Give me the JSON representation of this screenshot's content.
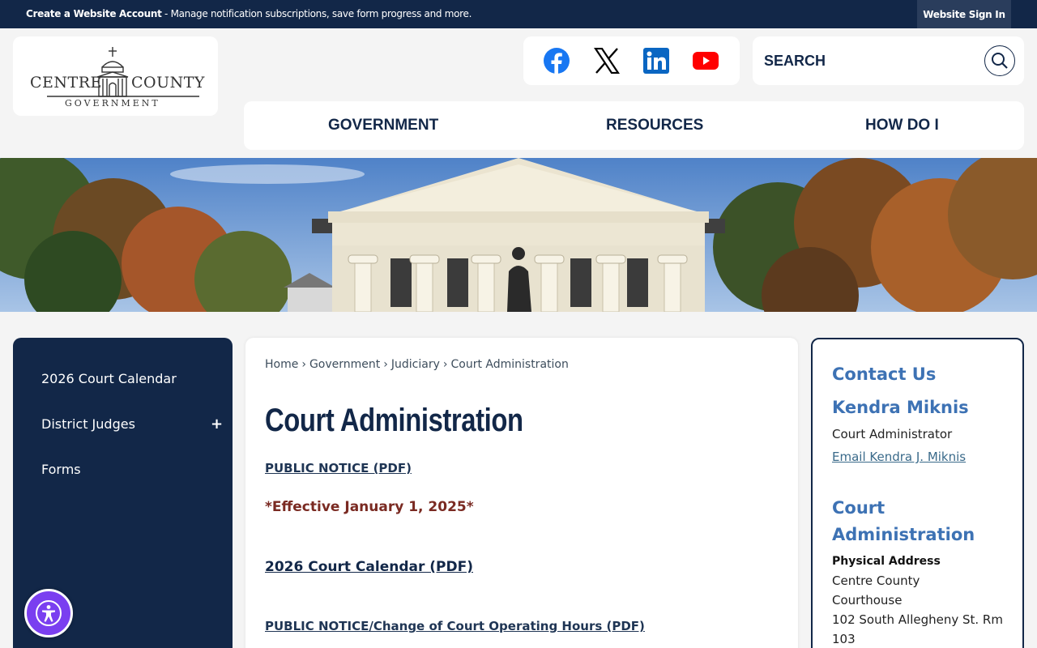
{
  "topbar": {
    "create_account": "Create a Website Account",
    "message": " - Manage notification subscriptions, save form progress and more.",
    "signin": "Website Sign In"
  },
  "logo": {
    "left": "CENTRE",
    "right": "COUNTY",
    "sub": "GOVERNMENT"
  },
  "social": [
    {
      "name": "facebook-icon",
      "color": "#1877f2"
    },
    {
      "name": "x-icon",
      "color": "#000000"
    },
    {
      "name": "linkedin-icon",
      "color": "#0a66c2"
    },
    {
      "name": "youtube-icon",
      "color": "#ff0000"
    }
  ],
  "search": {
    "placeholder": "SEARCH",
    "icon": "search-icon"
  },
  "nav": {
    "government": "GOVERNMENT",
    "resources": "RESOURCES",
    "how_do_i": "HOW DO I"
  },
  "sidebar": {
    "items": [
      {
        "label": "2026 Court Calendar"
      },
      {
        "label": "District Judges",
        "expand": "+"
      },
      {
        "label": "Forms"
      }
    ]
  },
  "breadcrumb": {
    "home": "Home",
    "government": "Government",
    "judiciary": "Judiciary",
    "current": "Court Administration",
    "sep": "›"
  },
  "main": {
    "title": "Court Administration",
    "public_notice": "PUBLIC NOTICE (PDF)",
    "effective": "*Effective January 1, 2025*",
    "calendar_link": "2026 Court Calendar (PDF)",
    "hours_notice": "PUBLIC NOTICE/Change of Court Operating Hours (PDF)"
  },
  "contact": {
    "heading": "Contact Us",
    "person": "Kendra Miknis",
    "role": "Court Administrator",
    "email": "Email Kendra J. Miknis",
    "office_line1": "Court",
    "office_line2": "Administration",
    "address_label": "Physical Address",
    "address_line1": "Centre County",
    "address_line2": "Courthouse",
    "address_line3": "102 South Allegheny St. Rm",
    "address_line4": "103"
  },
  "colors": {
    "navy": "#122748",
    "accent_blue": "#3d72b4",
    "effective_red": "#7a2a22",
    "a11y_purple": "#7a3ff0"
  }
}
